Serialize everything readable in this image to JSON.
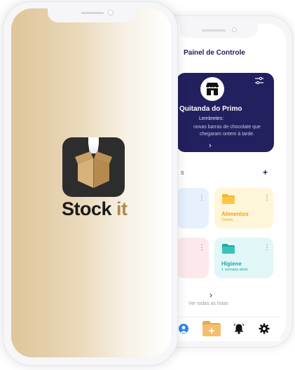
{
  "splash": {
    "app_name_main": "Stock ",
    "app_name_accent": "it",
    "logo_icon": "open-box-logo-icon"
  },
  "dashboard": {
    "title": "Painel de Controle",
    "store": {
      "name": "Quitanda do Primo",
      "reminders_label": "Lembretes:",
      "reminder_text": "novas barras de chocolate que chegaram ontem à tarde.",
      "icon": "storefront-icon"
    },
    "section_title_fragment": "s",
    "add_label": "+",
    "lists": [
      {
        "name": "Alimentos",
        "subtitle": "Ontem",
        "color": "#e8a516"
      },
      {
        "name": "Higiene",
        "subtitle": "1 semana atrás",
        "color": "#1fa8a4"
      }
    ],
    "see_all": "Ver todas as listas",
    "nav": [
      "user-icon",
      "add-folder-icon",
      "bell-icon",
      "gear-icon"
    ]
  },
  "colors": {
    "brand_navy": "#232060",
    "brand_gold": "#b08a4e",
    "splash_gradient_start": "#dfc59a"
  }
}
